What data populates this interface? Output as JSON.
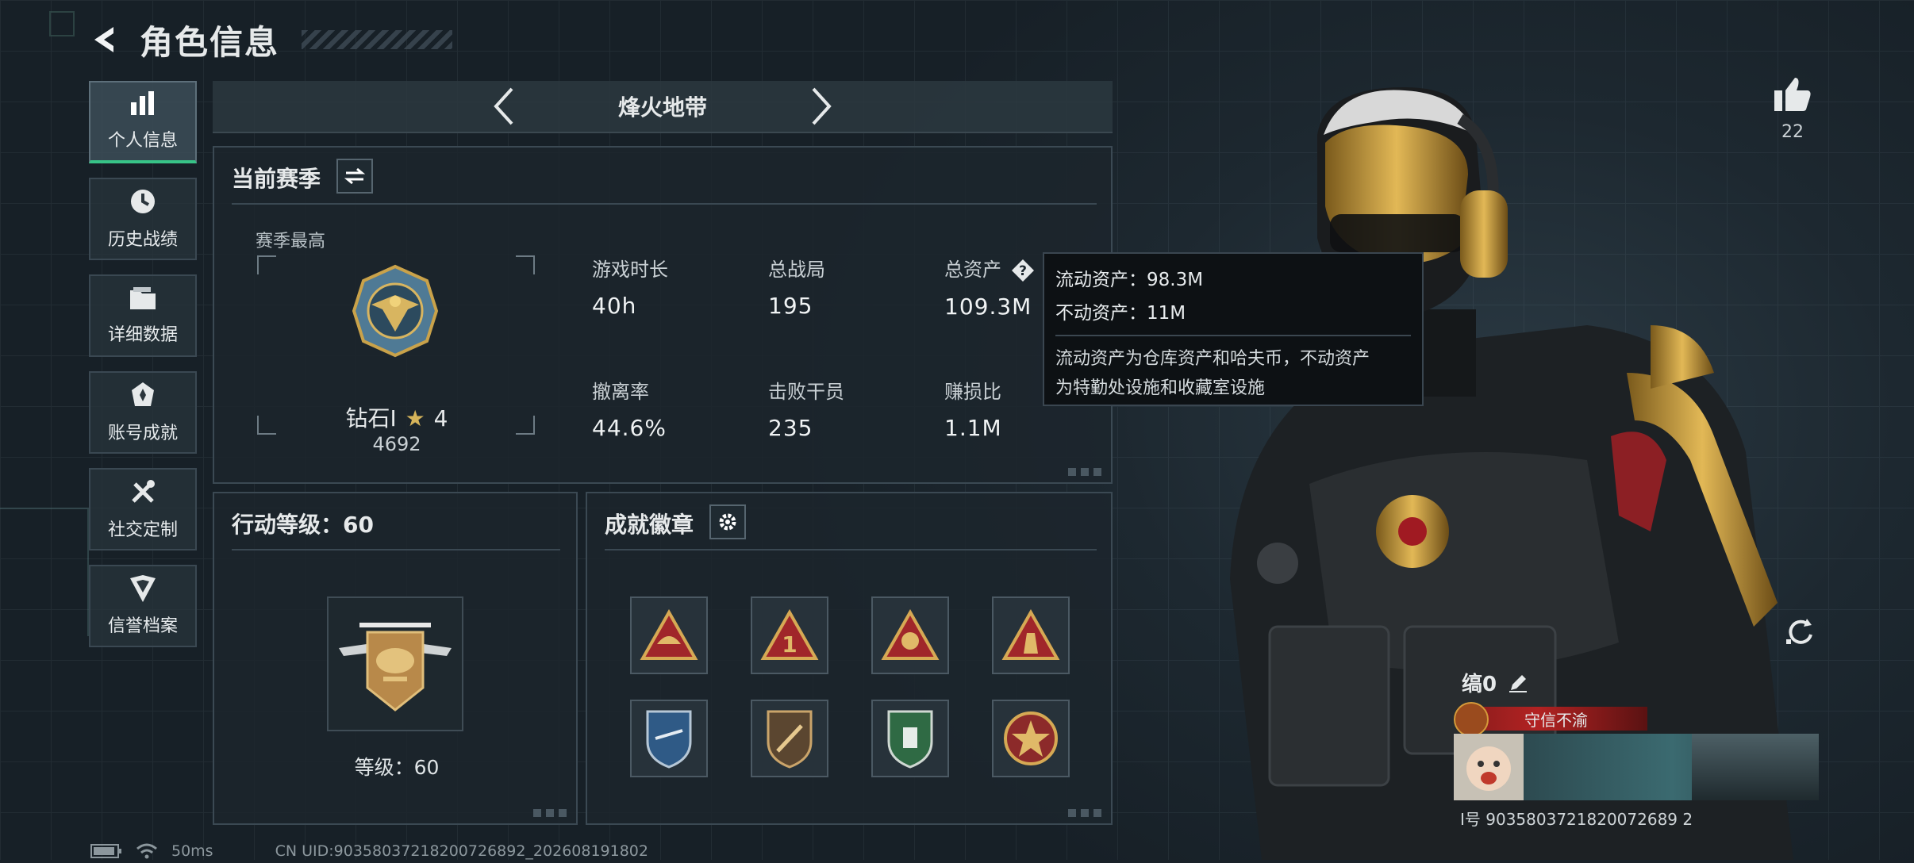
{
  "header": {
    "title": "角色信息"
  },
  "sidebar": {
    "items": [
      {
        "label": "个人信息",
        "icon": "bar-chart-icon",
        "active": true
      },
      {
        "label": "历史战绩",
        "icon": "history-clock-icon"
      },
      {
        "label": "详细数据",
        "icon": "folder-icon"
      },
      {
        "label": "账号成就",
        "icon": "achievement-icon"
      },
      {
        "label": "社交定制",
        "icon": "tools-icon"
      },
      {
        "label": "信誉档案",
        "icon": "credit-shield-icon"
      }
    ]
  },
  "mode": {
    "title": "烽火地带"
  },
  "season": {
    "title": "当前赛季",
    "best_label": "赛季最高",
    "rank_name": "钻石I",
    "rank_stars": "4",
    "rank_score": "4692",
    "stats": [
      {
        "label": "游戏时长",
        "value": "40h"
      },
      {
        "label": "总战局",
        "value": "195"
      },
      {
        "label": "总资产",
        "value": "109.3M"
      },
      {
        "label": "撤离率",
        "value": "44.6%"
      },
      {
        "label": "击败干员",
        "value": "235"
      },
      {
        "label": "赚损比",
        "value": "1.1M"
      }
    ]
  },
  "tooltip": {
    "liquid": "流动资产：98.3M",
    "fixed": "不动资产：11M",
    "desc_line1": "流动资产为仓库资产和哈夫币，不动资产",
    "desc_line2": "为特勤处设施和收藏室设施"
  },
  "level": {
    "title": "行动等级：60",
    "caption": "等级：60"
  },
  "badges": {
    "title": "成就徽章",
    "items": [
      "badge-gold-triangle-1",
      "badge-red-triangle-1",
      "badge-gold-triangle-2",
      "badge-gold-triangle-3",
      "badge-blue-shield",
      "badge-bronze-shield",
      "badge-green-shield",
      "badge-red-star"
    ]
  },
  "likes": {
    "count": "22"
  },
  "profile": {
    "nickname": "缟0",
    "credit_label": "守信不渝",
    "id_line": "I号 9035803721820072689 2"
  },
  "status": {
    "ping": "50ms",
    "uid": "CN UID:90358037218200726892_202608191802"
  },
  "colors": {
    "accent": "#37c387",
    "panel": "#1c262d",
    "credit": "#b22222"
  }
}
